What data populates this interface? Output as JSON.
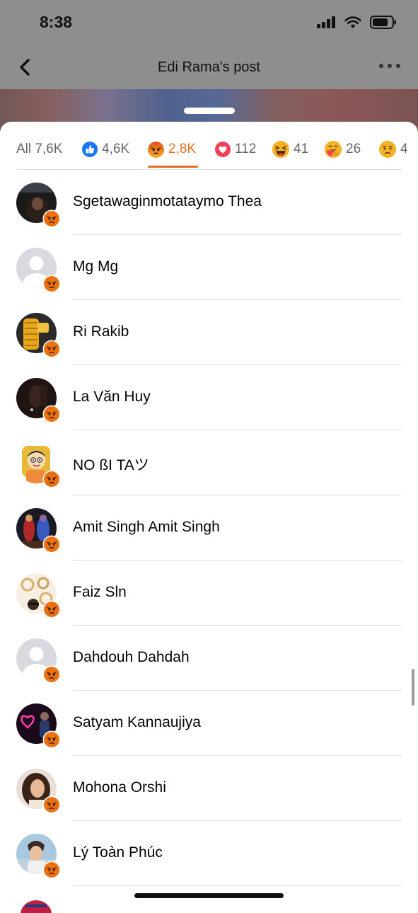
{
  "status_bar": {
    "time": "8:38"
  },
  "nav": {
    "title": "Edi Rama's post"
  },
  "tabs": [
    {
      "label": "All 7,6K",
      "icon": "none",
      "active": false
    },
    {
      "label": "4,6K",
      "icon": "like-icon",
      "active": false
    },
    {
      "label": "2,8K",
      "icon": "angry-icon",
      "active": true
    },
    {
      "label": "112",
      "icon": "love-icon",
      "active": false
    },
    {
      "label": "41",
      "icon": "haha-icon",
      "active": false
    },
    {
      "label": "26",
      "icon": "care-icon",
      "active": false
    },
    {
      "label": "4",
      "icon": "sad-icon",
      "active": false
    }
  ],
  "colors": {
    "accent": "#e4701f",
    "like": "#1877f2",
    "love": "#f33e58",
    "emoji_yellow": "#f7b125",
    "angry": "#e9710f"
  },
  "people": [
    {
      "name": "Sgetawaginmotataymo Thea",
      "avatar": "photo"
    },
    {
      "name": "Mg Mg",
      "avatar": "default"
    },
    {
      "name": "Ri Rakib",
      "avatar": "photo"
    },
    {
      "name": "La Văn Huy",
      "avatar": "photo"
    },
    {
      "name": "NO ßI TAツ",
      "avatar": "cartoon"
    },
    {
      "name": "Amit Singh Amit Singh",
      "avatar": "photo"
    },
    {
      "name": "Faiz Sln",
      "avatar": "photo"
    },
    {
      "name": "Dahdouh Dahdah",
      "avatar": "default"
    },
    {
      "name": "Satyam Kannaujiya",
      "avatar": "photo"
    },
    {
      "name": "Mohona Orshi",
      "avatar": "photo"
    },
    {
      "name": "Lý Toàn Phúc",
      "avatar": "photo"
    }
  ]
}
